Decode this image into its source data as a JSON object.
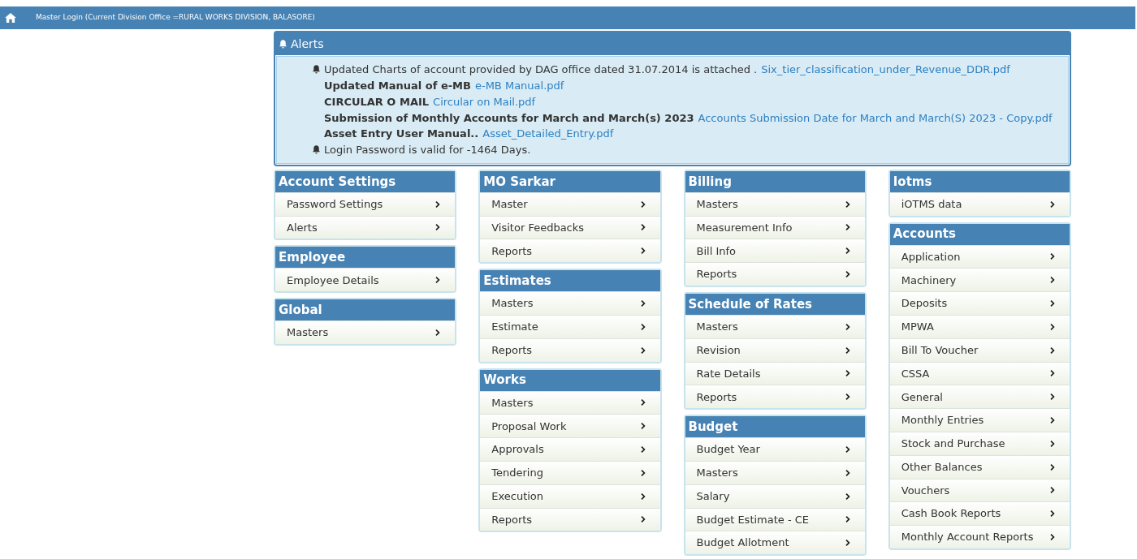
{
  "top_bar": {
    "title": "Master Login (Current Division Office =RURAL WORKS DIVISION, BALASORE)"
  },
  "alerts": {
    "title": "Alerts",
    "lines": [
      {
        "kind": "bell",
        "text": "Updated Charts of account provided by DAG office dated 31.07.2014 is attached .",
        "link": "Six_tier_classification_under_Revenue_DDR.pdf"
      },
      {
        "kind": "plain",
        "text": "Updated Manual of e-MB",
        "link": "e-MB Manual.pdf"
      },
      {
        "kind": "plain",
        "text": "CIRCULAR O MAIL",
        "link": "Circular on Mail.pdf"
      },
      {
        "kind": "plain",
        "text": "Submission of Monthly Accounts for March and March(s) 2023",
        "link": "Accounts Submission Date for March and March(S) 2023 - Copy.pdf"
      },
      {
        "kind": "plain",
        "text": "Asset Entry User Manual..",
        "link": "Asset_Detailed_Entry.pdf"
      },
      {
        "kind": "bell",
        "text": "Login Password is valid for -1464 Days."
      }
    ]
  },
  "columns": [
    [
      {
        "title": "Account Settings",
        "items": [
          "Password Settings",
          "Alerts"
        ]
      },
      {
        "title": "Employee",
        "items": [
          "Employee Details"
        ]
      },
      {
        "title": "Global",
        "items": [
          "Masters"
        ]
      }
    ],
    [
      {
        "title": "MO Sarkar",
        "items": [
          "Master",
          "Visitor Feedbacks",
          "Reports"
        ]
      },
      {
        "title": "Estimates",
        "items": [
          "Masters",
          "Estimate",
          "Reports"
        ]
      },
      {
        "title": "Works",
        "items": [
          "Masters",
          "Proposal Work",
          "Approvals",
          "Tendering",
          "Execution",
          "Reports"
        ]
      }
    ],
    [
      {
        "title": "Billing",
        "items": [
          "Masters",
          "Measurement Info",
          "Bill Info",
          "Reports"
        ]
      },
      {
        "title": "Schedule of Rates",
        "items": [
          "Masters",
          "Revision",
          "Rate Details",
          "Reports"
        ]
      },
      {
        "title": "Budget",
        "items": [
          "Budget Year",
          "Masters",
          "Salary",
          "Budget Estimate - CE",
          "Budget Allotment"
        ]
      }
    ],
    [
      {
        "title": "Iotms",
        "items": [
          "iOTMS data"
        ]
      },
      {
        "title": "Accounts",
        "items": [
          "Application",
          "Machinery",
          "Deposits",
          "MPWA",
          "Bill To Voucher",
          "CSSA",
          "General",
          "Monthly Entries",
          "Stock and Purchase",
          "Other Balances",
          "Vouchers",
          "Cash Book Reports",
          "Monthly Account Reports"
        ]
      }
    ]
  ]
}
